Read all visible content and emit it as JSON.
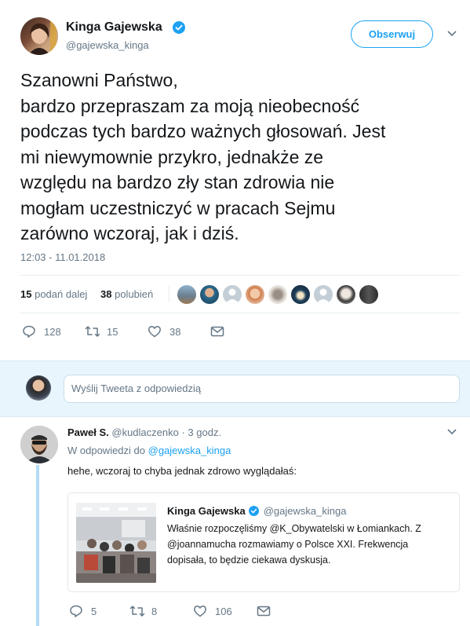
{
  "tweet": {
    "author_name": "Kinga Gajewska",
    "author_handle": "@gajewska_kinga",
    "follow_label": "Obserwuj",
    "text_lines": [
      "Szanowni Państwo,",
      "bardzo przepraszam za moją nieobecność",
      "podczas tych bardzo ważnych głosowań. Jest",
      "mi niewymownie przykro, jednakże ze",
      "względu na bardzo zły stan zdrowia nie",
      "mogłam uczestniczyć w pracach Sejmu",
      "zarówno wczoraj, jak i dziś."
    ],
    "timestamp": "12:03 - 11.01.2018",
    "retweets_count": "15",
    "retweets_label": "podań dalej",
    "likes_count": "38",
    "likes_label": "polubień",
    "actions": {
      "reply": "128",
      "retweet": "15",
      "like": "38"
    }
  },
  "reply_box": {
    "placeholder": "Wyślij Tweeta z odpowiedzią"
  },
  "reply": {
    "author_name": "Paweł S.",
    "author_handle": "@kudlaczenko",
    "time": "· 3 godz.",
    "in_reply_prefix": "W odpowiedzi do",
    "in_reply_handle": "@gajewska_kinga",
    "text": "hehe, wczoraj to chyba jednak zdrowo wyglądałaś:",
    "quote": {
      "author_name": "Kinga Gajewska",
      "author_handle": "@gajewska_kinga",
      "text_lines": [
        "Właśnie rozpoczęliśmy @K_Obywatelski w Łomiankach.  Z",
        "@joannamucha rozmawiamy o Polsce XXI. Frekwencja",
        "dopisała, to będzie ciekawa dyskusja."
      ]
    },
    "actions": {
      "reply": "5",
      "retweet": "8",
      "like": "106"
    }
  },
  "colors": {
    "accent": "#1da1f2",
    "muted": "#657786",
    "verified": "#1da1f2"
  }
}
